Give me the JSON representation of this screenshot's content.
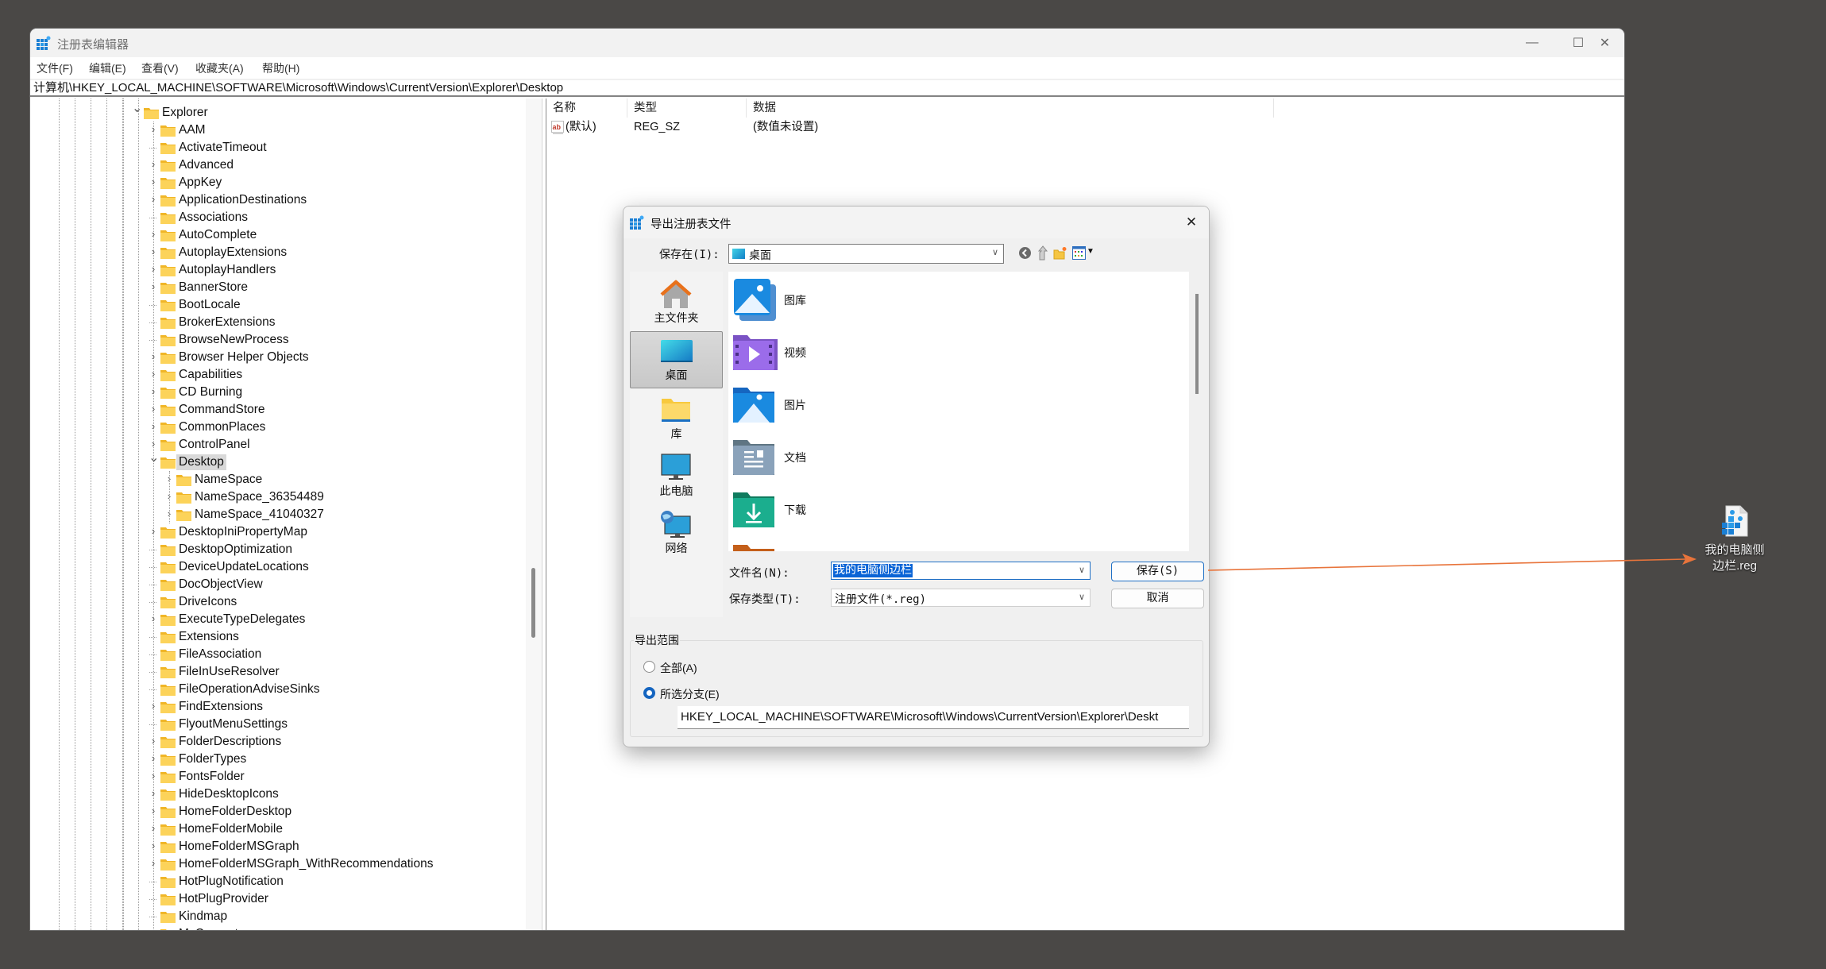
{
  "window": {
    "title": "注册表编辑器",
    "controls": {
      "minimize": "—",
      "maximize": "☐",
      "close": "✕"
    }
  },
  "menu": [
    "文件(F)",
    "编辑(E)",
    "查看(V)",
    "收藏夹(A)",
    "帮助(H)"
  ],
  "address": "计算机\\HKEY_LOCAL_MACHINE\\SOFTWARE\\Microsoft\\Windows\\CurrentVersion\\Explorer\\Desktop",
  "tree": {
    "parent": {
      "label": "Explorer",
      "expanded": true
    },
    "items": [
      {
        "label": "AAM",
        "expandable": true,
        "level": 1
      },
      {
        "label": "ActivateTimeout",
        "expandable": false,
        "level": 1
      },
      {
        "label": "Advanced",
        "expandable": true,
        "level": 1
      },
      {
        "label": "AppKey",
        "expandable": true,
        "level": 1
      },
      {
        "label": "ApplicationDestinations",
        "expandable": true,
        "level": 1
      },
      {
        "label": "Associations",
        "expandable": false,
        "level": 1
      },
      {
        "label": "AutoComplete",
        "expandable": true,
        "level": 1
      },
      {
        "label": "AutoplayExtensions",
        "expandable": true,
        "level": 1
      },
      {
        "label": "AutoplayHandlers",
        "expandable": true,
        "level": 1
      },
      {
        "label": "BannerStore",
        "expandable": true,
        "level": 1
      },
      {
        "label": "BootLocale",
        "expandable": false,
        "level": 1
      },
      {
        "label": "BrokerExtensions",
        "expandable": false,
        "level": 1
      },
      {
        "label": "BrowseNewProcess",
        "expandable": false,
        "level": 1
      },
      {
        "label": "Browser Helper Objects",
        "expandable": true,
        "level": 1
      },
      {
        "label": "Capabilities",
        "expandable": true,
        "level": 1
      },
      {
        "label": "CD Burning",
        "expandable": true,
        "level": 1
      },
      {
        "label": "CommandStore",
        "expandable": true,
        "level": 1
      },
      {
        "label": "CommonPlaces",
        "expandable": true,
        "level": 1
      },
      {
        "label": "ControlPanel",
        "expandable": true,
        "level": 1
      },
      {
        "label": "Desktop",
        "expandable": true,
        "expanded": true,
        "selected": true,
        "level": 1
      },
      {
        "label": "NameSpace",
        "expandable": true,
        "level": 2
      },
      {
        "label": "NameSpace_36354489",
        "expandable": true,
        "level": 2
      },
      {
        "label": "NameSpace_41040327",
        "expandable": true,
        "level": 2
      },
      {
        "label": "DesktopIniPropertyMap",
        "expandable": true,
        "level": 1
      },
      {
        "label": "DesktopOptimization",
        "expandable": false,
        "level": 1
      },
      {
        "label": "DeviceUpdateLocations",
        "expandable": false,
        "level": 1
      },
      {
        "label": "DocObjectView",
        "expandable": false,
        "level": 1
      },
      {
        "label": "DriveIcons",
        "expandable": false,
        "level": 1
      },
      {
        "label": "ExecuteTypeDelegates",
        "expandable": true,
        "level": 1
      },
      {
        "label": "Extensions",
        "expandable": false,
        "level": 1
      },
      {
        "label": "FileAssociation",
        "expandable": false,
        "level": 1
      },
      {
        "label": "FileInUseResolver",
        "expandable": false,
        "level": 1
      },
      {
        "label": "FileOperationAdviseSinks",
        "expandable": false,
        "level": 1
      },
      {
        "label": "FindExtensions",
        "expandable": true,
        "level": 1
      },
      {
        "label": "FlyoutMenuSettings",
        "expandable": false,
        "level": 1
      },
      {
        "label": "FolderDescriptions",
        "expandable": true,
        "level": 1
      },
      {
        "label": "FolderTypes",
        "expandable": true,
        "level": 1
      },
      {
        "label": "FontsFolder",
        "expandable": true,
        "level": 1
      },
      {
        "label": "HideDesktopIcons",
        "expandable": true,
        "level": 1
      },
      {
        "label": "HomeFolderDesktop",
        "expandable": true,
        "level": 1
      },
      {
        "label": "HomeFolderMobile",
        "expandable": true,
        "level": 1
      },
      {
        "label": "HomeFolderMSGraph",
        "expandable": true,
        "level": 1
      },
      {
        "label": "HomeFolderMSGraph_WithRecommendations",
        "expandable": true,
        "level": 1
      },
      {
        "label": "HotPlugNotification",
        "expandable": false,
        "level": 1
      },
      {
        "label": "HotPlugProvider",
        "expandable": false,
        "level": 1
      },
      {
        "label": "Kindmap",
        "expandable": false,
        "level": 1
      },
      {
        "label": "MyComputer",
        "expandable": true,
        "level": 1
      }
    ]
  },
  "values": {
    "columns": [
      "名称",
      "类型",
      "数据"
    ],
    "rows": [
      {
        "name": "(默认)",
        "type": "REG_SZ",
        "data": "(数值未设置)",
        "icon": "string-value-icon"
      }
    ]
  },
  "dialog": {
    "title": "导出注册表文件",
    "save_in_label": "保存在(I):",
    "save_in_value": "桌面",
    "places": [
      {
        "label": "主文件夹",
        "icon": "home-icon"
      },
      {
        "label": "桌面",
        "icon": "desktop-icon",
        "selected": true
      },
      {
        "label": "库",
        "icon": "library-icon"
      },
      {
        "label": "此电脑",
        "icon": "this-pc-icon"
      },
      {
        "label": "网络",
        "icon": "network-icon"
      }
    ],
    "files": [
      {
        "label": "图库",
        "icon": "gallery-icon"
      },
      {
        "label": "视频",
        "icon": "videos-folder-icon"
      },
      {
        "label": "图片",
        "icon": "pictures-folder-icon"
      },
      {
        "label": "文档",
        "icon": "documents-folder-icon"
      },
      {
        "label": "下载",
        "icon": "downloads-folder-icon"
      }
    ],
    "filename_label": "文件名(N):",
    "filename_value": "我的电脑侧边栏",
    "filetype_label": "保存类型(T):",
    "filetype_value": "注册文件(*.reg)",
    "save_button": "保存(S)",
    "cancel_button": "取消",
    "range_group": "导出范围",
    "range_all": "全部(A)",
    "range_selected": "所选分支(E)",
    "range_selected_checked": true,
    "branch_path": "HKEY_LOCAL_MACHINE\\SOFTWARE\\Microsoft\\Windows\\CurrentVersion\\Explorer\\Deskt"
  },
  "desktop_file": {
    "label_line1": "我的电脑侧",
    "label_line2": "边栏.reg"
  },
  "annotation_arrow_color": "#e8743b"
}
